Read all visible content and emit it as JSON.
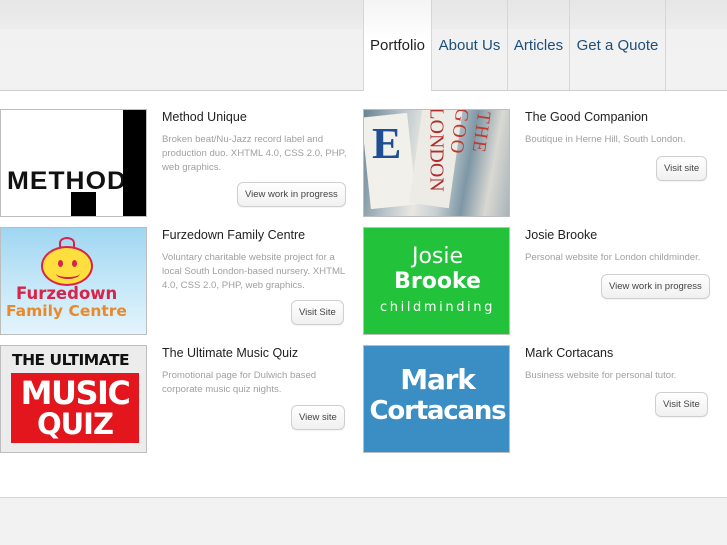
{
  "nav": {
    "items": [
      {
        "label": "Portfolio",
        "active": true
      },
      {
        "label": "About Us",
        "active": false
      },
      {
        "label": "Articles",
        "active": false
      },
      {
        "label": "Get a Quote",
        "active": false
      }
    ]
  },
  "portfolio": [
    {
      "title": "Method Unique",
      "description": "Broken beat/Nu-Jazz record label and production duo. XHTML 4.0, CSS 2.0, PHP, web graphics.",
      "button": "View work in progress",
      "logo_text": "METHOD"
    },
    {
      "title": "The Good Companion",
      "description": "Boutique in Herne Hill, South London.",
      "button": "Visit site",
      "logo_text": [
        "E",
        "LONDON",
        "THE GOO"
      ]
    },
    {
      "title": "Furzedown Family Centre",
      "description": "Voluntary charitable website project for a local South London-based nursery. XHTML 4.0, CSS 2.0, PHP, web graphics.",
      "button": "Visit Site",
      "logo_text": [
        "Furzedown",
        "Family",
        "Centre"
      ]
    },
    {
      "title": "Josie Brooke",
      "description": "Personal website for London childminder.",
      "button": "View work in progress",
      "logo_text": [
        "Josie",
        "Brooke",
        "childminding"
      ]
    },
    {
      "title": "The Ultimate Music Quiz",
      "description": "Promotional page for Dulwich based corporate music quiz nights.",
      "button": "View site",
      "logo_text": [
        "THE ULTIMATE",
        "MUSIC",
        "QUIZ"
      ]
    },
    {
      "title": "Mark Cortacans",
      "description": "Business website for personal tutor.",
      "button": "Visit Site",
      "logo_text": [
        "Mark",
        "Cortacans"
      ]
    }
  ],
  "colors": {
    "nav_link": "#1d4e7a",
    "josie_green": "#22c33a",
    "music_red": "#e2161c",
    "mark_blue": "#3a8ec4",
    "furzedown_red": "#d8234a",
    "furzedown_blue": "#2a4d9c"
  }
}
